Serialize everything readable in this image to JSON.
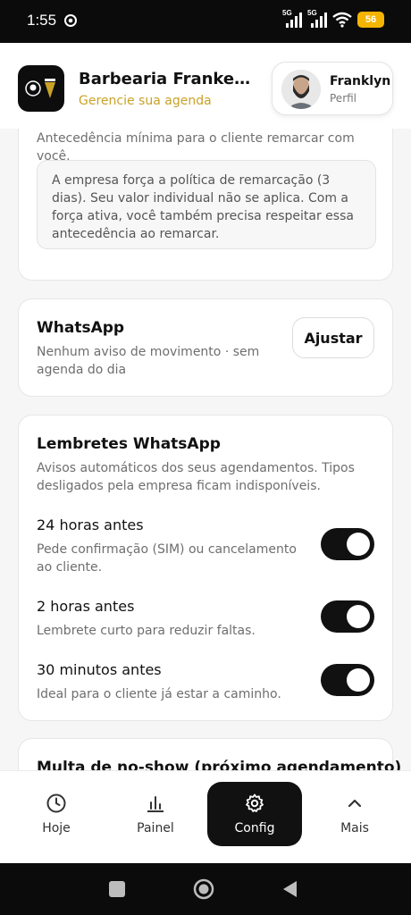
{
  "status_bar": {
    "time": "1:55",
    "net1": "5G",
    "net2": "5G",
    "battery": "56"
  },
  "header": {
    "business_name": "Barbearia Frankens...",
    "subtitle": "Gerencie sua agenda",
    "profile_name": "Franklyn",
    "profile_label": "Perfil"
  },
  "reschedule_card": {
    "description": "Antecedência mínima para o cliente remarcar com você.",
    "notice": "A empresa força a política de remarcação (3 dias). Seu valor individual não se aplica. Com a força ativa, você também precisa respeitar essa antecedência ao remarcar."
  },
  "whatsapp_card": {
    "title": "WhatsApp",
    "description": "Nenhum aviso de movimento · sem agenda do dia",
    "button": "Ajustar"
  },
  "reminders_card": {
    "title": "Lembretes WhatsApp",
    "description": "Avisos automáticos dos seus agendamentos. Tipos desligados pela empresa ficam indisponíveis.",
    "items": [
      {
        "title": "24 horas antes",
        "description": "Pede confirmação (SIM) ou cancelamento ao cliente.",
        "enabled": true
      },
      {
        "title": "2 horas antes",
        "description": "Lembrete curto para reduzir faltas.",
        "enabled": true
      },
      {
        "title": "30 minutos antes",
        "description": "Ideal para o cliente já estar a caminho.",
        "enabled": true
      }
    ]
  },
  "noshow_card": {
    "title": "Multa de no-show (próximo agendamento)"
  },
  "bottom_nav": {
    "items": [
      {
        "label": "Hoje",
        "icon": "clock-icon"
      },
      {
        "label": "Painel",
        "icon": "bar-chart-icon"
      },
      {
        "label": "Config",
        "icon": "gear-icon",
        "active": true
      },
      {
        "label": "Mais",
        "icon": "chevron-up-icon"
      }
    ]
  },
  "colors": {
    "accent_gold": "#c9a227",
    "active_nav": "#111111",
    "toggle_on": "#111111",
    "battery": "#f4b400"
  }
}
